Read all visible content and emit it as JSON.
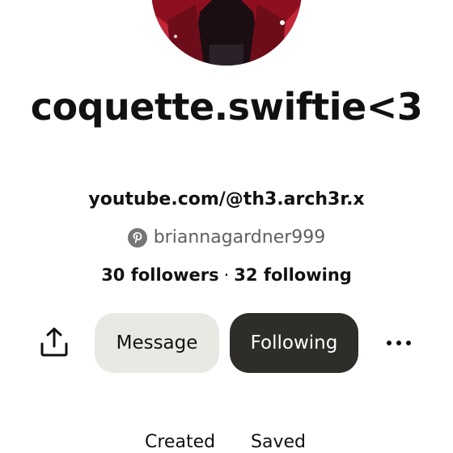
{
  "profile": {
    "display_name": "coquette.swiftie<3",
    "website": "youtube.com/@th3.arch3r.x",
    "username": "briannagardner999",
    "followers": "30 followers",
    "separator": "·",
    "following": "32 following"
  },
  "actions": {
    "message_label": "Message",
    "following_label": "Following"
  },
  "tabs": [
    {
      "label": "Created"
    },
    {
      "label": "Saved"
    }
  ],
  "icons": {
    "share": "share-icon",
    "more": "more-icon",
    "pinterest": "pinterest-icon"
  },
  "colors": {
    "following_button_bg": "#2e2d29",
    "message_button_bg": "#e9e9e4",
    "username_text": "#5f5f5f"
  }
}
